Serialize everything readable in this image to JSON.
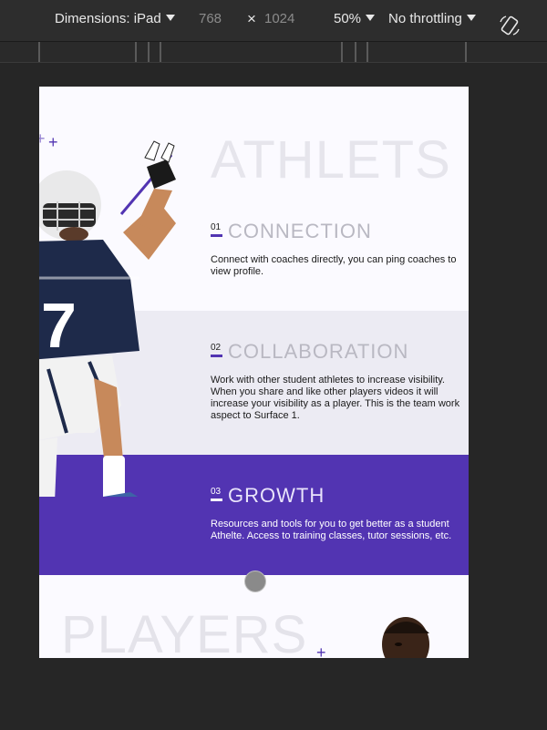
{
  "devtools": {
    "dimensions_label": "Dimensions: iPad",
    "width": "768",
    "times": "×",
    "height": "1024",
    "zoom": "50%",
    "throttling": "No throttling",
    "rotate_icon": "rotate-icon"
  },
  "page": {
    "athletes_title": "ATHLETS",
    "features": [
      {
        "number": "01",
        "title": "CONNECTION",
        "description": "Connect with coaches directly, you can ping coaches to view profile."
      },
      {
        "number": "02",
        "title": "COLLABORATION",
        "description": "Work with other student athletes to increase visibility. When you share and like other players videos it will increase your visibility as a player. This is the team work aspect to Surface 1."
      },
      {
        "number": "03",
        "title": "GROWTH",
        "description": "Resources and tools for you to get better as a student Athelte. Access to training classes, tutor sessions, etc."
      }
    ],
    "players_title": "PLAYERS",
    "plus_glyph": "+"
  },
  "colors": {
    "accent": "#5234b2",
    "light_band": "#ecebf3",
    "page_bg": "#fbfaff"
  }
}
